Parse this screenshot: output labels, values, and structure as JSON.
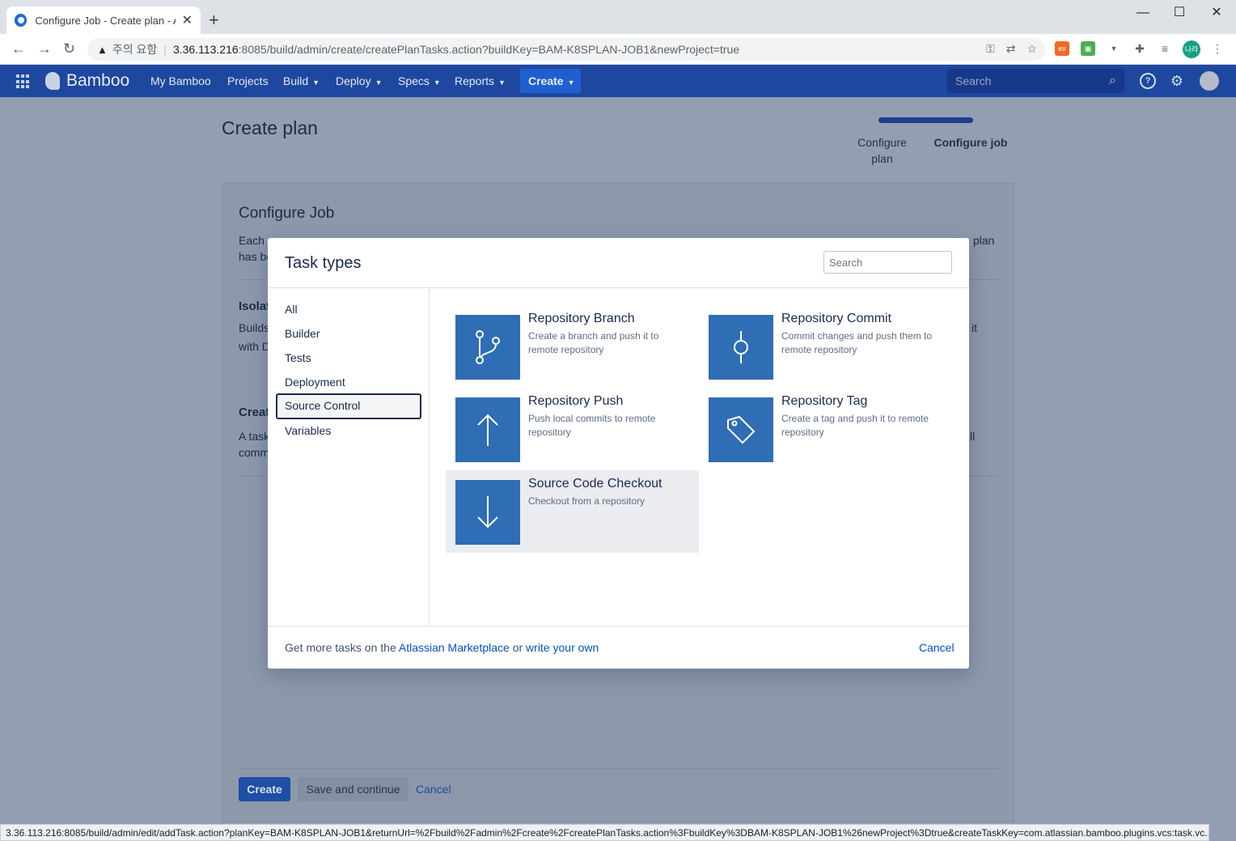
{
  "browser": {
    "tab_title": "Configure Job - Create plan - A",
    "warning_label": "주의 요함",
    "url_host": "3.36.113.216",
    "url_rest": ":8085/build/admin/create/createPlanTasks.action?buildKey=BAM-K8SPLAN-JOB1&newProject=true",
    "profile_initials": "나라",
    "status_url": "3.36.113.216:8085/build/admin/edit/addTask.action?planKey=BAM-K8SPLAN-JOB1&returnUrl=%2Fbuild%2Fadmin%2Fcreate%2FcreatePlanTasks.action%3FbuildKey%3DBAM-K8SPLAN-JOB1%26newProject%3Dtrue&createTaskKey=com.atlassian.bamboo.plugins.vcs:task.vc..."
  },
  "header": {
    "logo": "Bamboo",
    "nav": [
      "My Bamboo",
      "Projects",
      "Build",
      "Deploy",
      "Specs",
      "Reports"
    ],
    "create_label": "Create",
    "search_placeholder": "Search"
  },
  "page": {
    "title": "Create plan",
    "steps": [
      "Configure plan",
      "Configure job"
    ],
    "section_title": "Configure Job",
    "intro_line1_start": "Each p",
    "intro_line1_end": "plan",
    "intro_line2": "has be",
    "isolation_label": "Isolat",
    "isolation_line1": "Builds",
    "isolation_line1_end": "it",
    "isolation_line2": "with D",
    "create_label": "Creat",
    "create_line1": "A task",
    "create_line1_end": "ll",
    "create_line2": "comm",
    "btn_create": "Create",
    "btn_save": "Save and continue",
    "btn_cancel": "Cancel"
  },
  "dialog": {
    "title": "Task types",
    "search_placeholder": "Search",
    "categories": [
      "All",
      "Builder",
      "Tests",
      "Deployment",
      "Source Control",
      "Variables"
    ],
    "selected_category": "Source Control",
    "tasks": [
      {
        "name": "Repository Branch",
        "desc": "Create a branch and push it to remote repository",
        "icon": "branch-icon"
      },
      {
        "name": "Repository Commit",
        "desc": "Commit changes and push them to remote repository",
        "icon": "commit-icon"
      },
      {
        "name": "Repository Push",
        "desc": "Push local commits to remote repository",
        "icon": "arrow-up-icon"
      },
      {
        "name": "Repository Tag",
        "desc": "Create a tag and push it to remote repository",
        "icon": "tag-icon"
      },
      {
        "name": "Source Code Checkout",
        "desc": "Checkout from a repository",
        "icon": "arrow-down-icon"
      }
    ],
    "footer_prefix": "Get more tasks on the",
    "footer_link1": "Atlassian Marketplace",
    "footer_mid": "or",
    "footer_link2": "write your own",
    "cancel_label": "Cancel"
  }
}
